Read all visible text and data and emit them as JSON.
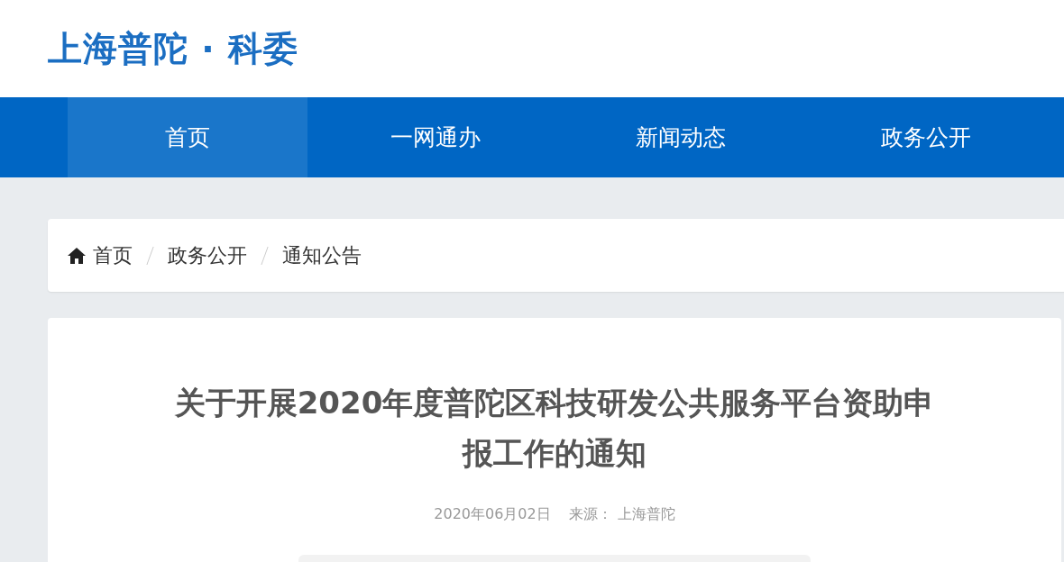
{
  "logo": {
    "text": "上海普陀 · 科委"
  },
  "nav": [
    {
      "label": "首页",
      "selected": true
    },
    {
      "label": "一网通办",
      "selected": false
    },
    {
      "label": "新闻动态",
      "selected": false
    },
    {
      "label": "政务公开",
      "selected": false
    }
  ],
  "breadcrumb": [
    "首页",
    "政务公开",
    "通知公告"
  ],
  "article": {
    "title": "关于开展2020年度普陀区科技研发公共服务平台资助申报工作的通知",
    "date": "2020年06月02日",
    "source_label": "来源：",
    "source": "上海普陀"
  }
}
